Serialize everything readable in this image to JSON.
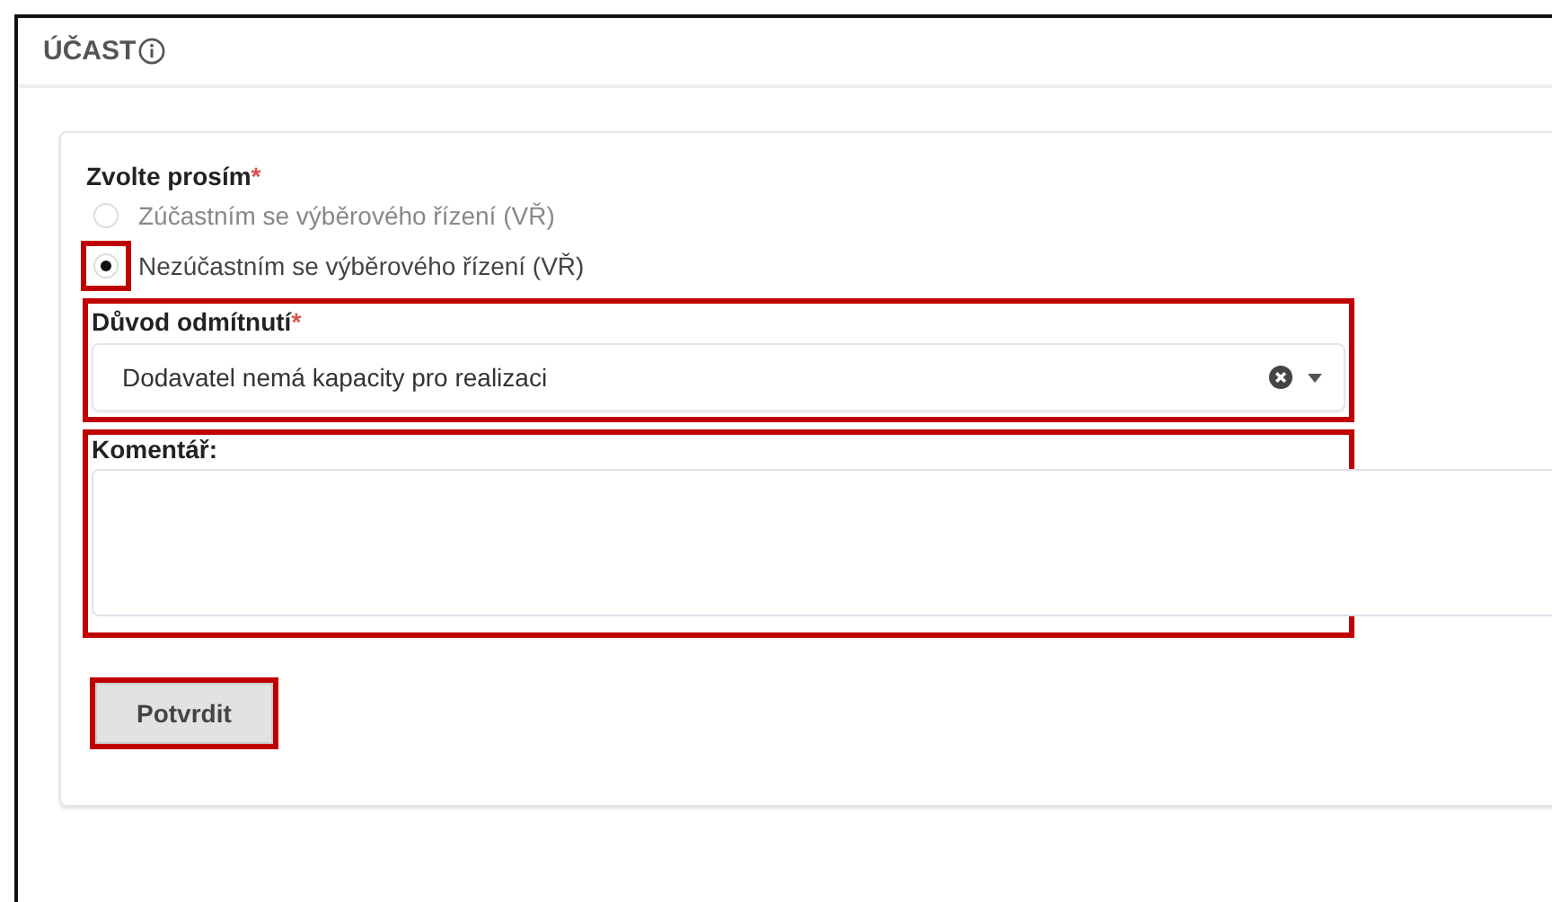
{
  "section": {
    "title": "ÚČAST"
  },
  "choice": {
    "label": "Zvolte prosím",
    "required_mark": "*",
    "options": [
      {
        "label": "Zúčastním se výběrového řízení (VŘ)",
        "selected": false,
        "highlighted": false
      },
      {
        "label": "Nezúčastním se výběrového řízení (VŘ)",
        "selected": true,
        "highlighted": true
      }
    ]
  },
  "reason": {
    "label": "Důvod odmítnutí",
    "required_mark": "*",
    "value": "Dodavatel nemá kapacity pro realizaci",
    "highlighted": true
  },
  "comment": {
    "label": "Komentář:",
    "highlighted": true
  },
  "submit": {
    "label": "Potvrdit",
    "highlighted": true
  }
}
